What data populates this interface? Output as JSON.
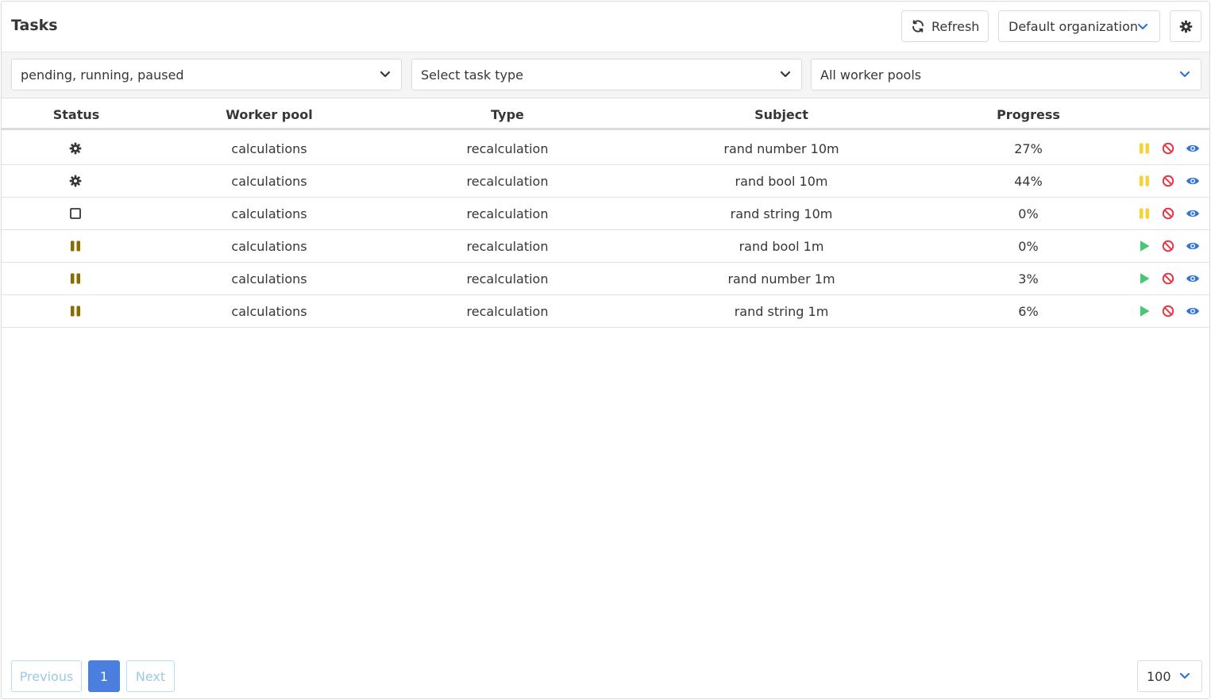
{
  "header": {
    "title": "Tasks",
    "refresh_label": "Refresh",
    "organization": "Default organization"
  },
  "filters": {
    "status_value": "pending, running, paused",
    "type_placeholder": "Select task type",
    "pool_value": "All worker pools"
  },
  "table": {
    "columns": [
      "Status",
      "Worker pool",
      "Type",
      "Subject",
      "Progress"
    ],
    "rows": [
      {
        "status": "running",
        "worker_pool": "calculations",
        "type": "recalculation",
        "subject": "rand number 10m",
        "progress": "27%",
        "action": "pause"
      },
      {
        "status": "running",
        "worker_pool": "calculations",
        "type": "recalculation",
        "subject": "rand bool 10m",
        "progress": "44%",
        "action": "pause"
      },
      {
        "status": "pending",
        "worker_pool": "calculations",
        "type": "recalculation",
        "subject": "rand string 10m",
        "progress": "0%",
        "action": "pause"
      },
      {
        "status": "paused",
        "worker_pool": "calculations",
        "type": "recalculation",
        "subject": "rand bool 1m",
        "progress": "0%",
        "action": "resume"
      },
      {
        "status": "paused",
        "worker_pool": "calculations",
        "type": "recalculation",
        "subject": "rand number 1m",
        "progress": "3%",
        "action": "resume"
      },
      {
        "status": "paused",
        "worker_pool": "calculations",
        "type": "recalculation",
        "subject": "rand string 1m",
        "progress": "6%",
        "action": "resume"
      }
    ]
  },
  "pagination": {
    "previous_label": "Previous",
    "current_page": "1",
    "next_label": "Next",
    "per_page": "100"
  },
  "colors": {
    "accent": "#4a7fe0",
    "pause_action": "#f7d234",
    "paused_status": "#8a6d00",
    "resume_action": "#48c774",
    "cancel_action": "#e53945",
    "view_action": "#3273dc"
  },
  "icons": {
    "running": "gear-icon",
    "pending": "square-outline-icon",
    "paused": "pause-icon",
    "pause_action": "pause-icon",
    "resume_action": "play-icon",
    "cancel_action": "ban-icon",
    "view_action": "eye-icon"
  }
}
